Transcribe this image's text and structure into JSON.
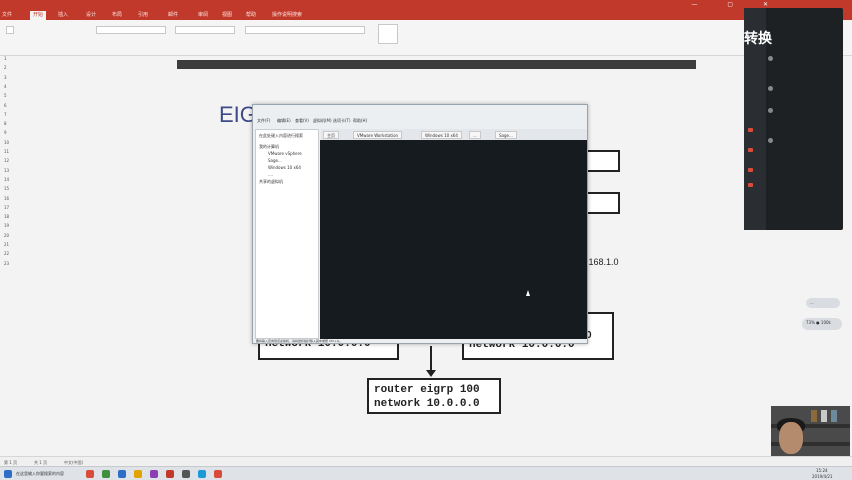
{
  "word": {
    "tabs": [
      "文件",
      "开始",
      "插入",
      "设计",
      "布局",
      "引用",
      "邮件",
      "审阅",
      "视图",
      "帮助",
      "操作说明搜索"
    ],
    "active_tab": "开始",
    "line_numbers": [
      "1",
      "2",
      "3",
      "4",
      "5",
      "6",
      "7",
      "8",
      "9",
      "10",
      "11",
      "12",
      "13",
      "14",
      "15",
      "16",
      "17",
      "18",
      "19",
      "20",
      "21",
      "22",
      "23"
    ],
    "status_page": "第 1 页",
    "status_words": "共 1 页",
    "status_lang": "中文(中国)"
  },
  "doc": {
    "heading": "EIG",
    "side_text": ".168.1.0",
    "box_left": "network 10.0.0.0",
    "box_right": "network 10.0.0.0",
    "box_bottom": "router eigrp 100\nnetwork 10.0.0.0",
    "box_right_fragment": "0"
  },
  "vmware": {
    "menu": [
      "文件(F)",
      "编辑(E)",
      "查看(V)",
      "虚拟机(M)",
      "选项卡(T)",
      "帮助(H)"
    ],
    "library": {
      "search": "在此处键入内容进行搜索",
      "root": "我的计算机",
      "items": [
        "VMware vSphere",
        "Sage...",
        "Windows 10 x64",
        "...."
      ],
      "shared": "共享的虚拟机"
    },
    "tabs": [
      "主页",
      "VMware Workstation",
      "Windows 10 x64",
      "...",
      "Sage..."
    ],
    "status": "要将输入定向到该虚拟机，请将鼠标指针移入其中或按 Ctrl+G。"
  },
  "chat": {
    "big_label": "转换",
    "bubble_1": "...",
    "bubble_2": "73% ● 100k"
  },
  "taskbar": {
    "time": "15:24",
    "date": "2019/4/21",
    "search_label": "在这里输入你要搜索的内容"
  },
  "colors": {
    "word_red": "#c1392b",
    "vm_screen": "#161b20",
    "heading_blue": "#3d4a8a"
  }
}
